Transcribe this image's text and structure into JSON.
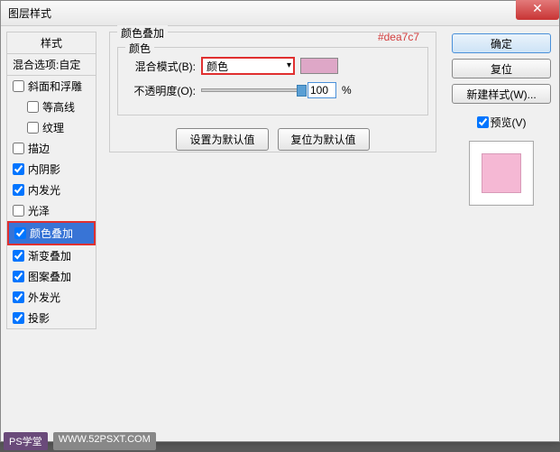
{
  "title": "图层样式",
  "close": "✕",
  "left": {
    "header": "样式",
    "blend": "混合选项:自定",
    "items": [
      {
        "label": "斜面和浮雕",
        "checked": false,
        "indent": false
      },
      {
        "label": "等高线",
        "checked": false,
        "indent": true
      },
      {
        "label": "纹理",
        "checked": false,
        "indent": true
      },
      {
        "label": "描边",
        "checked": false,
        "indent": false
      },
      {
        "label": "内阴影",
        "checked": true,
        "indent": false
      },
      {
        "label": "内发光",
        "checked": true,
        "indent": false
      },
      {
        "label": "光泽",
        "checked": false,
        "indent": false
      },
      {
        "label": "颜色叠加",
        "checked": true,
        "indent": false,
        "selected": true
      },
      {
        "label": "渐变叠加",
        "checked": true,
        "indent": false
      },
      {
        "label": "图案叠加",
        "checked": true,
        "indent": false
      },
      {
        "label": "外发光",
        "checked": true,
        "indent": false
      },
      {
        "label": "投影",
        "checked": true,
        "indent": false
      }
    ]
  },
  "center": {
    "groupTitle": "颜色叠加",
    "subTitle": "颜色",
    "hexAnnotation": "#dea7c7",
    "blendModeLabel": "混合模式(B):",
    "blendModeValue": "颜色",
    "opacityLabel": "不透明度(O):",
    "opacityValue": "100",
    "pct": "%",
    "btn1": "设置为默认值",
    "btn2": "复位为默认值"
  },
  "right": {
    "ok": "确定",
    "reset": "复位",
    "newStyle": "新建样式(W)...",
    "previewLabel": "预览(V)"
  },
  "watermark": {
    "name": "PS学堂",
    "url": "WWW.52PSXT.COM"
  }
}
